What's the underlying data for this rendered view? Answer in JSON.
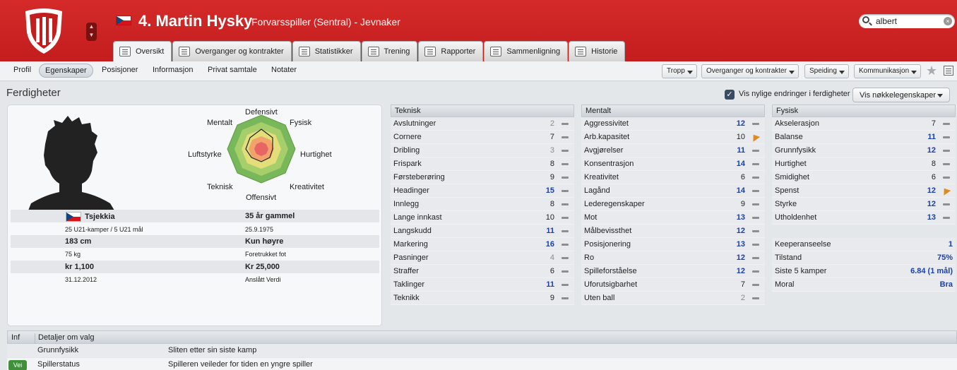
{
  "header": {
    "player_title": "4. Martin Hysky",
    "player_subtitle": "Forvarsspiller (Sentral) - Jevnaker",
    "search_value": "albert",
    "brand_color": "#c41d1d"
  },
  "tabs": [
    {
      "label": "Oversikt",
      "icon": "overview-icon",
      "active": true
    },
    {
      "label": "Overganger og kontrakter",
      "icon": "contract-icon"
    },
    {
      "label": "Statistikker",
      "icon": "stats-icon"
    },
    {
      "label": "Trening",
      "icon": "training-icon"
    },
    {
      "label": "Rapporter",
      "icon": "reports-icon"
    },
    {
      "label": "Sammenligning",
      "icon": "compare-icon"
    },
    {
      "label": "Historie",
      "icon": "history-icon"
    }
  ],
  "subnav": {
    "items": [
      "Profil",
      "Egenskaper",
      "Posisjoner",
      "Informasjon",
      "Privat samtale",
      "Notater"
    ],
    "active": "Egenskaper",
    "dropdowns": [
      "Tropp",
      "Overganger og kontrakter",
      "Speiding",
      "Kommunikasjon"
    ]
  },
  "section": {
    "title": "Ferdigheter",
    "checkbox_label": "Vis nylige endringer i ferdigheter",
    "key_button": "Vis nøkkelegenskaper"
  },
  "radar": {
    "labels": {
      "top": "Defensivt",
      "top_right": "Fysisk",
      "right": "Hurtighet",
      "bottom_right": "Kreativitet",
      "bottom": "Offensivt",
      "bottom_left": "Teknisk",
      "left": "Luftstyrke",
      "top_left": "Mentalt"
    }
  },
  "info": {
    "nationality": "Tsjekkia",
    "u21": "25 U21-kamper / 5 U21 mål",
    "age": "35 år gammel",
    "dob": "25.9.1975",
    "height": "183 cm",
    "weight": "75 kg",
    "foot": "Kun høyre",
    "foot_label": "Foretrukket fot",
    "wage": "kr 1,100",
    "contract_end": "31.12.2012",
    "value": "Kr 25,000",
    "value_label": "Anslått Verdi"
  },
  "teknisk": {
    "title": "Teknisk",
    "rows": [
      {
        "name": "Avslutninger",
        "value": "2"
      },
      {
        "name": "Cornere",
        "value": "7"
      },
      {
        "name": "Dribling",
        "value": "3"
      },
      {
        "name": "Frispark",
        "value": "8"
      },
      {
        "name": "Førsteberøring",
        "value": "9"
      },
      {
        "name": "Headinger",
        "value": "15"
      },
      {
        "name": "Innlegg",
        "value": "8"
      },
      {
        "name": "Lange innkast",
        "value": "10"
      },
      {
        "name": "Langskudd",
        "value": "11"
      },
      {
        "name": "Markering",
        "value": "16"
      },
      {
        "name": "Pasninger",
        "value": "4"
      },
      {
        "name": "Straffer",
        "value": "6"
      },
      {
        "name": "Taklinger",
        "value": "11"
      },
      {
        "name": "Teknikk",
        "value": "9"
      }
    ]
  },
  "mentalt": {
    "title": "Mentalt",
    "rows": [
      {
        "name": "Aggressivitet",
        "value": "12"
      },
      {
        "name": "Arb.kapasitet",
        "value": "10",
        "trend": "up"
      },
      {
        "name": "Avgjørelser",
        "value": "11"
      },
      {
        "name": "Konsentrasjon",
        "value": "14"
      },
      {
        "name": "Kreativitet",
        "value": "6"
      },
      {
        "name": "Lagånd",
        "value": "14"
      },
      {
        "name": "Lederegenskaper",
        "value": "9"
      },
      {
        "name": "Mot",
        "value": "13"
      },
      {
        "name": "Målbevissthet",
        "value": "12"
      },
      {
        "name": "Posisjonering",
        "value": "13"
      },
      {
        "name": "Ro",
        "value": "12"
      },
      {
        "name": "Spilleforståelse",
        "value": "12"
      },
      {
        "name": "Uforutsigbarhet",
        "value": "7"
      },
      {
        "name": "Uten ball",
        "value": "2"
      }
    ]
  },
  "fysisk": {
    "title": "Fysisk",
    "rows": [
      {
        "name": "Akselerasjon",
        "value": "7"
      },
      {
        "name": "Balanse",
        "value": "11"
      },
      {
        "name": "Grunnfysikk",
        "value": "12"
      },
      {
        "name": "Hurtighet",
        "value": "8"
      },
      {
        "name": "Smidighet",
        "value": "6"
      },
      {
        "name": "Spenst",
        "value": "12",
        "trend": "up"
      },
      {
        "name": "Styrke",
        "value": "12"
      },
      {
        "name": "Utholdenhet",
        "value": "13"
      }
    ],
    "extra": [
      {
        "name": "Keeperanseelse",
        "value": "1"
      },
      {
        "name": "Tilstand",
        "value": "75%"
      },
      {
        "name": "Siste 5 kamper",
        "value": "6.84 (1 mål)"
      },
      {
        "name": "Moral",
        "value": "Bra"
      }
    ]
  },
  "details": {
    "col1": "Inf",
    "col2": "Detaljer om valg",
    "rows": [
      {
        "badge": "",
        "label": "Grunnfysikk",
        "text": "Sliten etter sin siste kamp"
      },
      {
        "badge": "Vei",
        "label": "Spillerstatus",
        "text": "Spilleren veileder for tiden en yngre spiller"
      }
    ]
  }
}
